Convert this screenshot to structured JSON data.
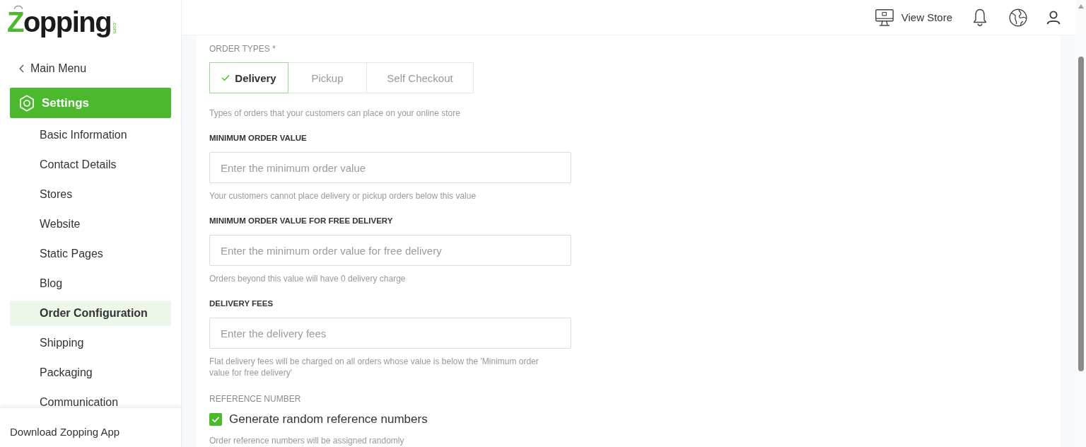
{
  "logo": {
    "name": "Zopping",
    "domain": ".com"
  },
  "topbar": {
    "view_store": "View Store"
  },
  "sidebar": {
    "back": "Main Menu",
    "section": "Settings",
    "items": [
      {
        "label": "Basic Information",
        "selected": false
      },
      {
        "label": "Contact Details",
        "selected": false
      },
      {
        "label": "Stores",
        "selected": false
      },
      {
        "label": "Website",
        "selected": false
      },
      {
        "label": "Static Pages",
        "selected": false
      },
      {
        "label": "Blog",
        "selected": false
      },
      {
        "label": "Order Configuration",
        "selected": true
      },
      {
        "label": "Shipping",
        "selected": false
      },
      {
        "label": "Packaging",
        "selected": false
      },
      {
        "label": "Communication",
        "selected": false
      }
    ],
    "footer": "Download Zopping App"
  },
  "form": {
    "order_types": {
      "label": "ORDER TYPES *",
      "options": [
        {
          "label": "Delivery",
          "selected": true
        },
        {
          "label": "Pickup",
          "selected": false
        },
        {
          "label": "Self Checkout",
          "selected": false
        }
      ],
      "help": "Types of orders that your customers can place on your online store"
    },
    "fields": [
      {
        "label": "MINIMUM ORDER VALUE",
        "placeholder": "Enter the minimum order value",
        "help": "Your customers cannot place delivery or pickup orders below this value"
      },
      {
        "label": "MINIMUM ORDER VALUE FOR FREE DELIVERY",
        "placeholder": "Enter the minimum order value for free delivery",
        "help": "Orders beyond this value will have 0 delivery charge"
      },
      {
        "label": "DELIVERY FEES",
        "placeholder": "Enter the delivery fees",
        "help": "Flat delivery fees will be charged on all orders whose value is below the 'Minimum order value for free delivery'"
      }
    ],
    "reference": {
      "label": "REFERENCE NUMBER",
      "checkbox": {
        "label": "Generate random reference numbers",
        "checked": true
      },
      "help": "Order reference numbers will be assigned randomly"
    }
  }
}
